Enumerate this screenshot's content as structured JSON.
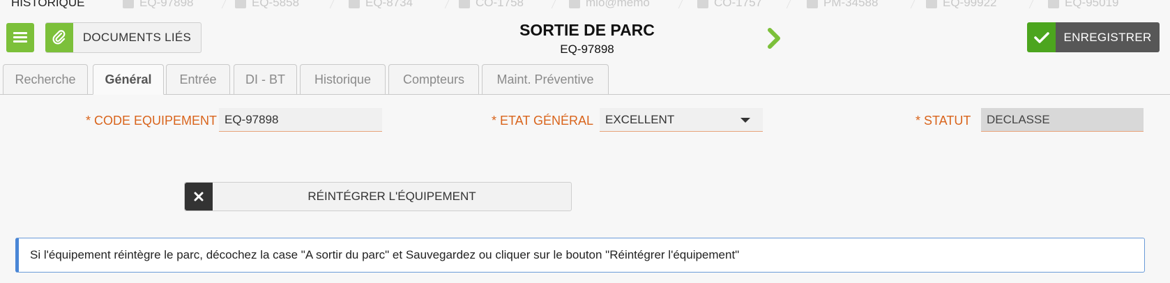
{
  "history": {
    "label": "HISTORIQUE",
    "items": [
      "EQ-97898",
      "EQ-5858",
      "EQ-8734",
      "CO-1758",
      "mlo@memo",
      "CO-1757",
      "PM-34588",
      "EQ-99922",
      "EQ-95019"
    ]
  },
  "header": {
    "docs_label": "DOCUMENTS LIÉS",
    "title": "SORTIE DE PARC",
    "subtitle": "EQ-97898",
    "save_label": "ENREGISTRER"
  },
  "tabs": [
    {
      "label": "Recherche"
    },
    {
      "label": "Général"
    },
    {
      "label": "Entrée"
    },
    {
      "label": "DI - BT"
    },
    {
      "label": "Historique"
    },
    {
      "label": "Compteurs"
    },
    {
      "label": "Maint. Préventive"
    }
  ],
  "active_tab": "Général",
  "form": {
    "code_label": "* CODE EQUIPEMENT",
    "code_value": "EQ-97898",
    "etat_label": "* ETAT GÉNÉRAL",
    "etat_value": "EXCELLENT",
    "statut_label": "* STATUT",
    "statut_value": "DECLASSE"
  },
  "reintegrate_label": "RÉINTÉGRER L'ÉQUIPEMENT",
  "info_text": "Si l'équipement réintègre le parc, décochez la case \"A sortir du parc\" et Sauvegardez ou cliquer sur le bouton \"Réintégrer l'équipement\"",
  "colors": {
    "accent_green": "#7cc03a",
    "required_orange": "#d9641c",
    "info_blue": "#4a86d6"
  },
  "icons": {
    "menu": "hamburger-icon",
    "docs": "paperclip-icon",
    "next": "chevron-right-icon",
    "save": "check-icon",
    "reintegrate": "close-icon",
    "select": "caret-down-icon"
  }
}
